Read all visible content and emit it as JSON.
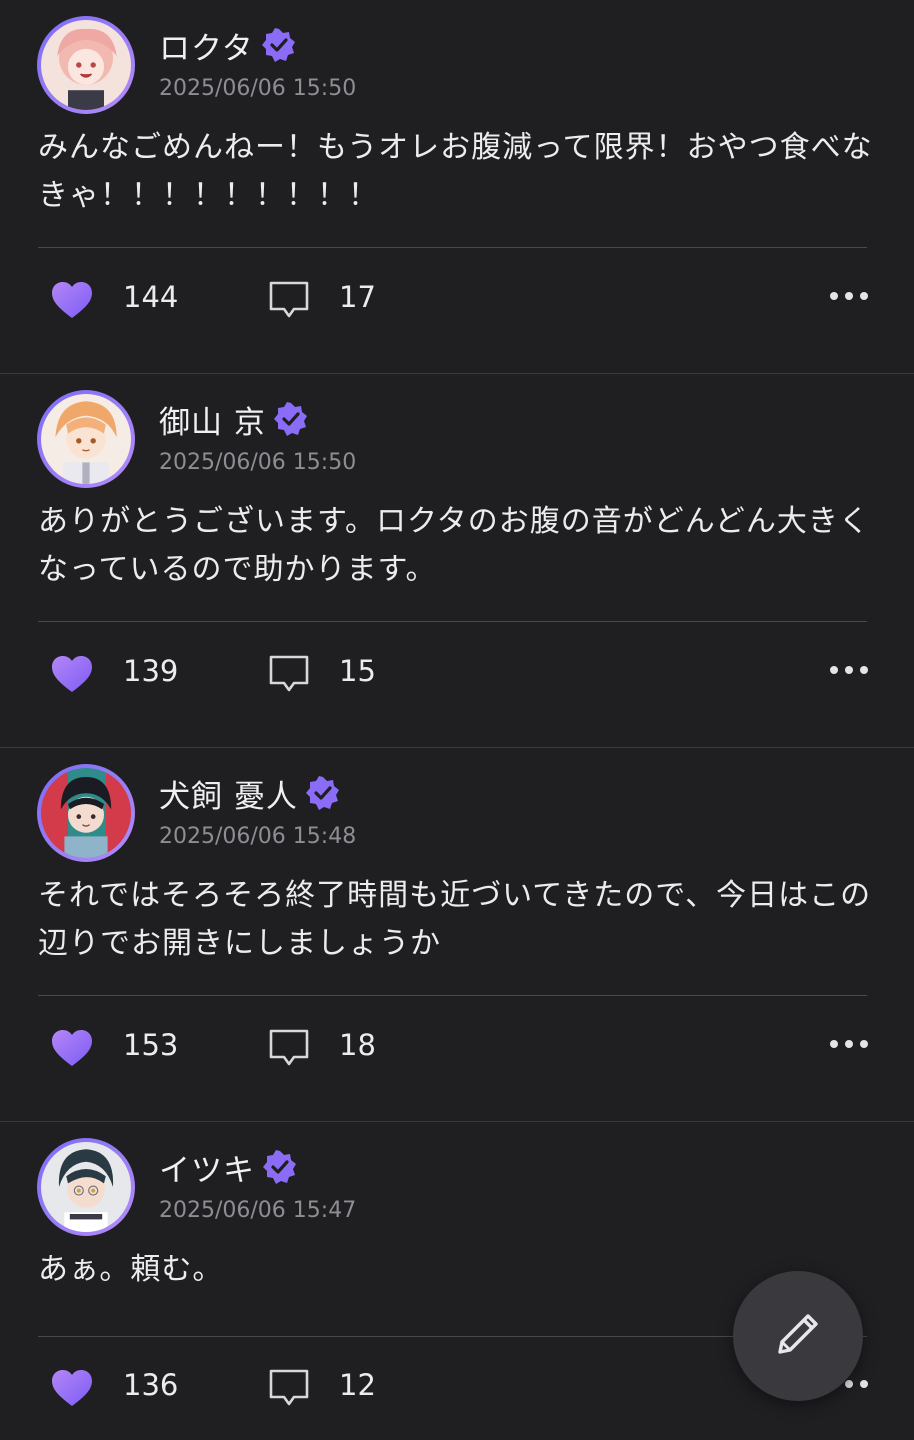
{
  "accent_color": "#8b6cf6",
  "posts": [
    {
      "author": "ロクタ",
      "verified": true,
      "timestamp": "2025/06/06 15:50",
      "body": "みんなごめんねー！もうオレお腹減って限界！おやつ食べなきゃ！！！！！！！！！",
      "likes": "144",
      "comments": "17",
      "avatar": "pink-haired-character"
    },
    {
      "author": "御山 京",
      "verified": true,
      "timestamp": "2025/06/06 15:50",
      "body": "ありがとうございます。ロクタのお腹の音がどんどん大きくなっているので助かります。",
      "likes": "139",
      "comments": "15",
      "avatar": "orange-haired-character"
    },
    {
      "author": "犬飼 憂人",
      "verified": true,
      "timestamp": "2025/06/06 15:48",
      "body": "それではそろそろ終了時間も近づいてきたので、今日はこの辺りでお開きにしましょうか",
      "likes": "153",
      "comments": "18",
      "avatar": "dark-haired-character"
    },
    {
      "author": "イツキ",
      "verified": true,
      "timestamp": "2025/06/06 15:47",
      "body": "あぁ。頼む。",
      "likes": "136",
      "comments": "12",
      "avatar": "dark-haired-character-glasses"
    }
  ],
  "icons": {
    "like": "heart-icon",
    "comment": "comment-icon",
    "more": "more-dots-icon",
    "compose": "pencil-icon",
    "verified": "verified-badge-icon"
  }
}
